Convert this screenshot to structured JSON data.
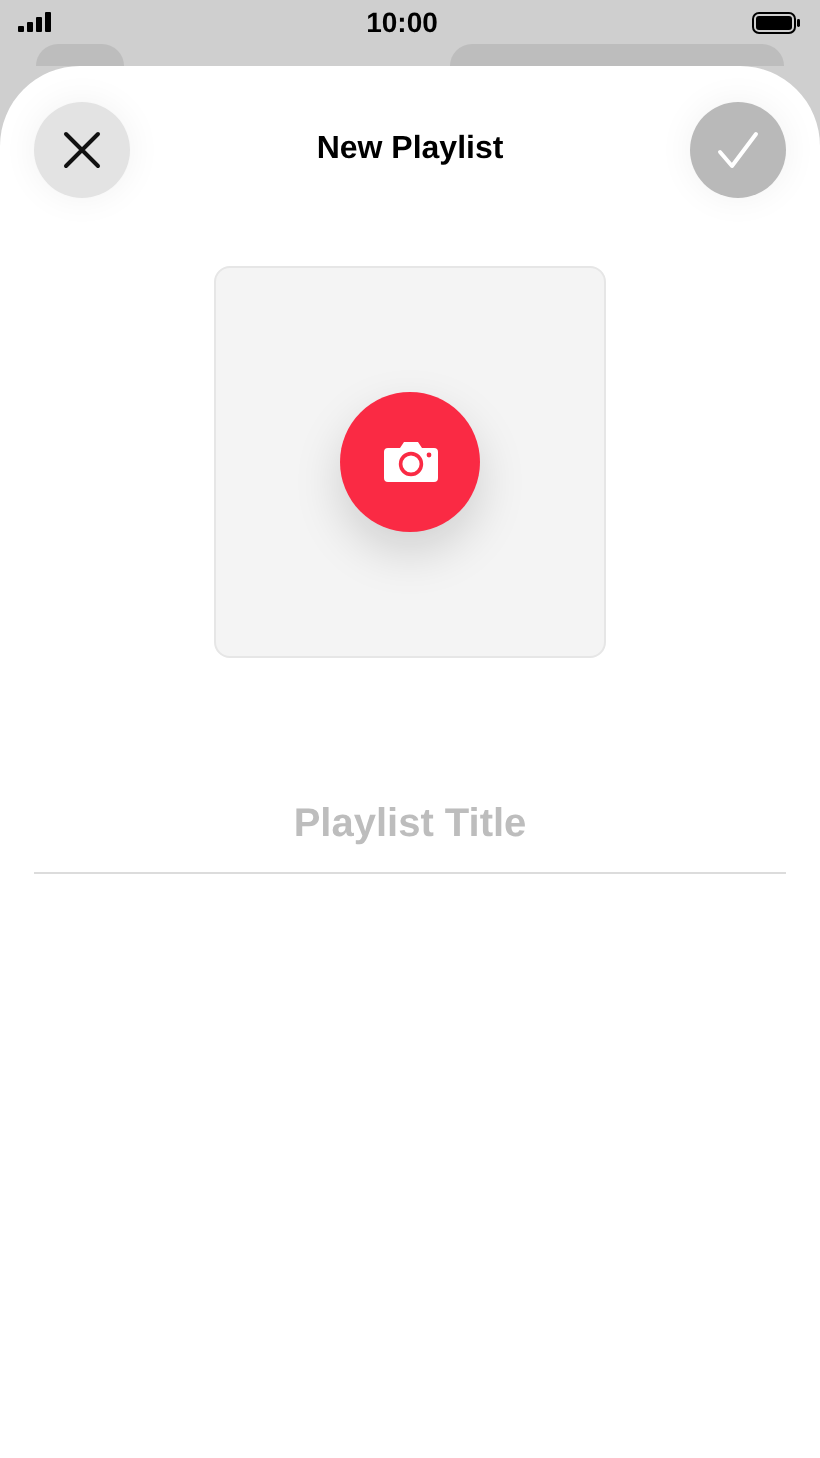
{
  "status_bar": {
    "time": "10:00"
  },
  "sheet": {
    "title": "New Playlist",
    "done_button": {
      "disabled": true
    }
  },
  "artwork": {
    "kind": "camera"
  },
  "title_field": {
    "placeholder": "Playlist Title"
  }
}
